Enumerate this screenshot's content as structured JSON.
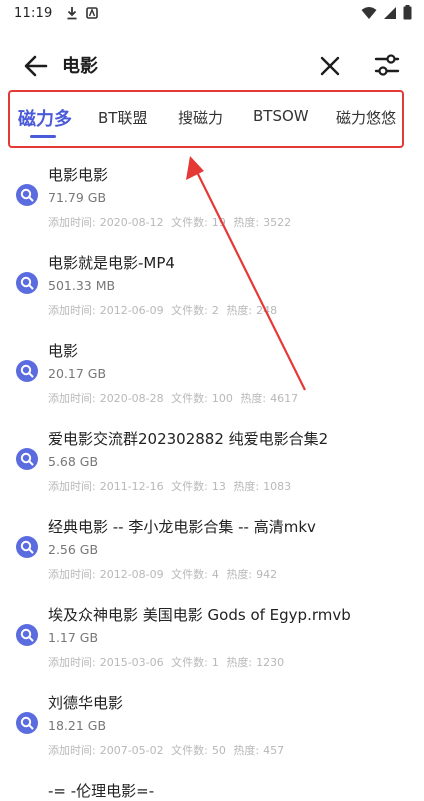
{
  "status": {
    "time": "11:19"
  },
  "toolbar": {
    "title": "电影"
  },
  "tabs": [
    {
      "label": "磁力多",
      "active": true
    },
    {
      "label": "BT联盟",
      "active": false
    },
    {
      "label": "搜磁力",
      "active": false
    },
    {
      "label": "BTSOW",
      "active": false
    },
    {
      "label": "磁力悠悠",
      "active": false
    }
  ],
  "labels": {
    "added": "添加时间:",
    "files": "文件数:",
    "heat": "热度:"
  },
  "results": [
    {
      "name": "电影电影",
      "size": "71.79 GB",
      "date": "2020-08-12",
      "files": "19",
      "heat": "3522"
    },
    {
      "name": "电影就是电影-MP4",
      "size": "501.33 MB",
      "date": "2012-06-09",
      "files": "2",
      "heat": "248"
    },
    {
      "name": "电影",
      "size": "20.17 GB",
      "date": "2020-08-28",
      "files": "100",
      "heat": "4617"
    },
    {
      "name": "爱电影交流群202302882 纯爱电影合集2",
      "size": "5.68 GB",
      "date": "2011-12-16",
      "files": "13",
      "heat": "1083"
    },
    {
      "name": "经典电影 -- 李小龙电影合集 -- 高清mkv",
      "size": "2.56 GB",
      "date": "2012-08-09",
      "files": "4",
      "heat": "942"
    },
    {
      "name": "埃及众神电影 美国电影 Gods of Egyp.rmvb",
      "size": "1.17 GB",
      "date": "2015-03-06",
      "files": "1",
      "heat": "1230"
    },
    {
      "name": "刘德华电影",
      "size": "18.21 GB",
      "date": "2007-05-02",
      "files": "50",
      "heat": "457"
    },
    {
      "name": "-= -伦理电影=-",
      "size": "",
      "date": "",
      "files": "",
      "heat": ""
    }
  ],
  "colors": {
    "accent": "#4a5ad8",
    "annotation": "#e53935"
  }
}
